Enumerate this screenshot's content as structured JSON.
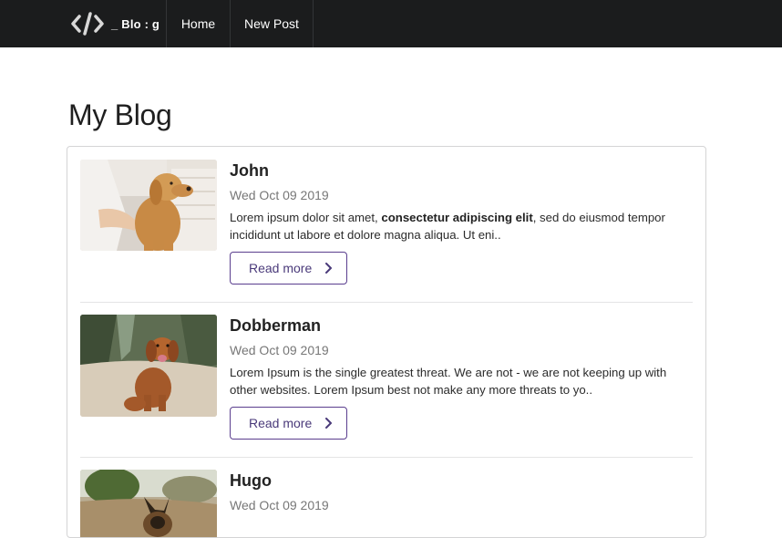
{
  "navbar": {
    "brand_text": "_ Blo : g",
    "brand_icon": "code-brackets-icon",
    "items": [
      {
        "label": "Home"
      },
      {
        "label": "New Post"
      }
    ]
  },
  "page": {
    "title": "My Blog"
  },
  "posts": [
    {
      "title": "John",
      "date": "Wed Oct 09 2019",
      "excerpt_before": "Lorem ipsum dolor sit amet, ",
      "excerpt_bold": "consectetur adipiscing elit",
      "excerpt_after": ", sed do eiusmod tempor incididunt ut labore et dolore magna aliqua. Ut eni..",
      "button_label": "Read more",
      "image": "golden-retriever-photo"
    },
    {
      "title": "Dobberman",
      "date": "Wed Oct 09 2019",
      "excerpt_before": "Lorem Ipsum is the single greatest threat. We are not - we are not keeping up with other websites. Lorem Ipsum best not make any more threats to yo..",
      "excerpt_bold": "",
      "excerpt_after": "",
      "button_label": "Read more",
      "image": "brown-dog-photo"
    },
    {
      "title": "Hugo",
      "date": "Wed Oct 09 2019",
      "image": "german-shepherd-photo"
    }
  ],
  "colors": {
    "navbar_bg": "#1b1c1d",
    "button_border": "#5a3e8e",
    "button_text": "#4a3a7a"
  }
}
